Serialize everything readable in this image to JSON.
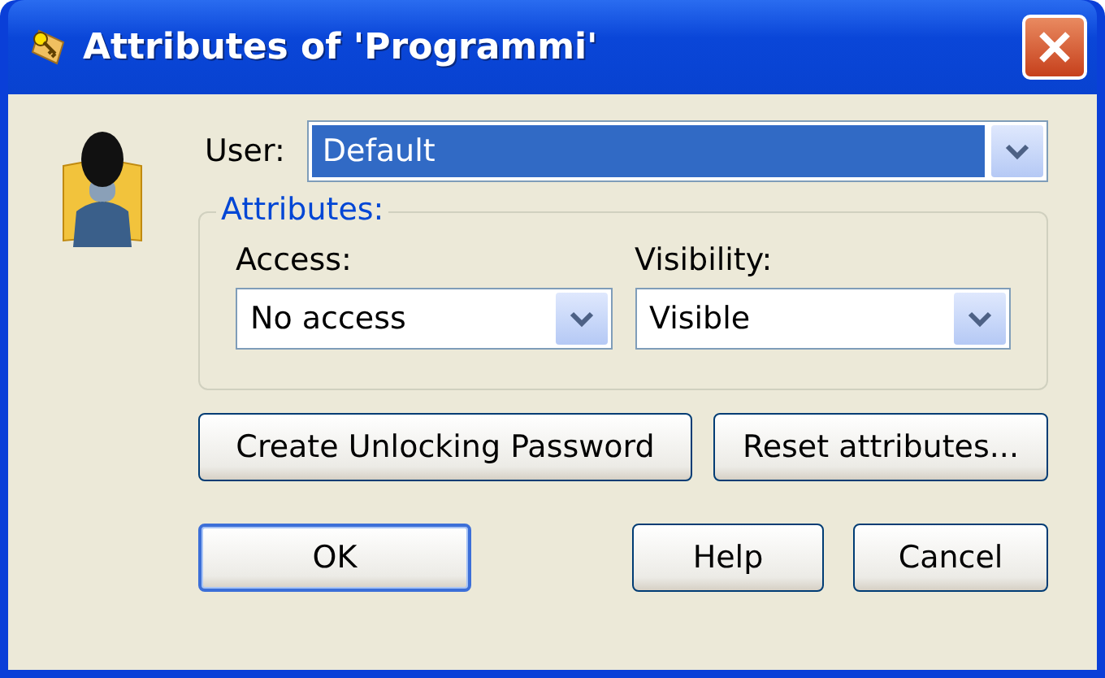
{
  "window": {
    "title": "Attributes of 'Programmi'"
  },
  "user": {
    "label": "User:",
    "value": "Default",
    "focused": true
  },
  "attributes": {
    "legend": "Attributes:",
    "fields": [
      {
        "label": "Access:",
        "value": "No access",
        "focused": false
      },
      {
        "label": "Visibility:",
        "value": "Visible",
        "focused": false
      }
    ]
  },
  "action_buttons": [
    {
      "label": "Create Unlocking Password",
      "default": false
    },
    {
      "label": "Reset attributes...",
      "default": false
    }
  ],
  "dialog_buttons": [
    {
      "label": "OK",
      "default": true
    },
    {
      "label": "Help",
      "default": false
    },
    {
      "label": "Cancel",
      "default": false
    }
  ]
}
